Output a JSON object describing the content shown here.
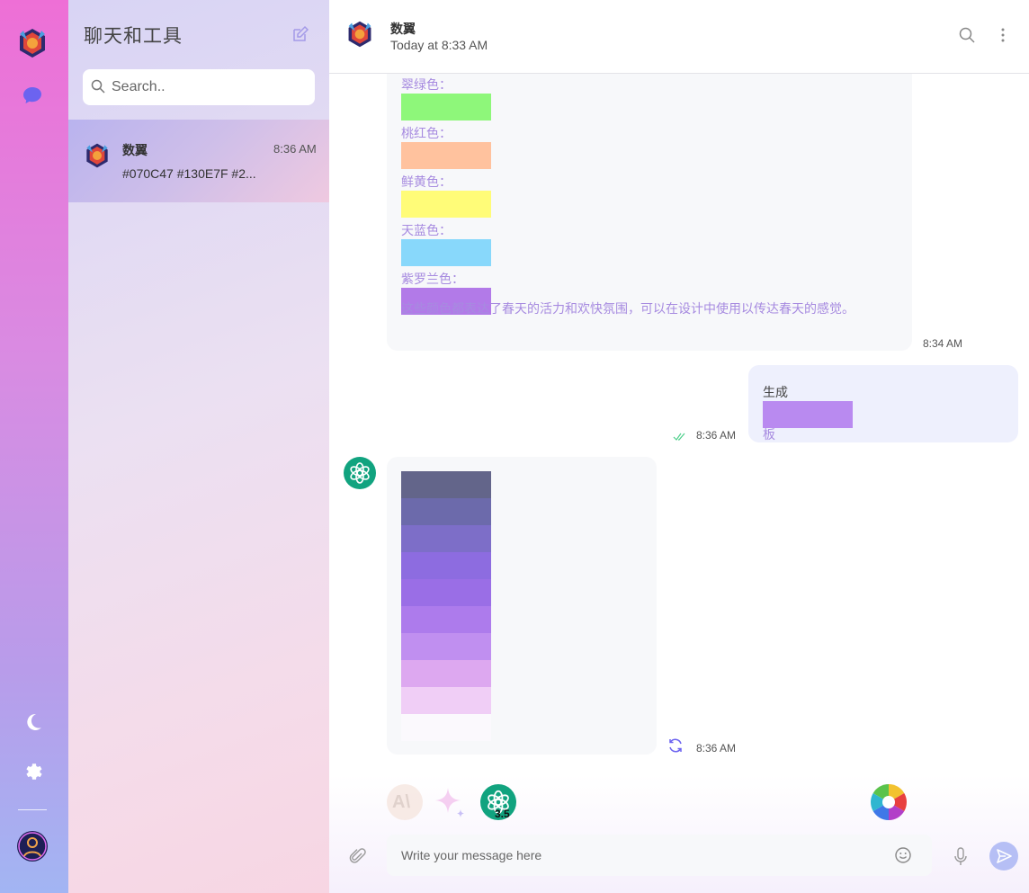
{
  "sidebar": {
    "icons": [
      "app-logo-icon",
      "chat-bubble-icon",
      "moon-icon",
      "gear-icon",
      "user-avatar-icon"
    ]
  },
  "chat_list": {
    "title": "聊天和工具",
    "search_placeholder": "Search..",
    "items": [
      {
        "name": "数翼",
        "time": "8:36 AM",
        "preview": "#070C47 #130E7F #2..."
      }
    ]
  },
  "header": {
    "name": "数翼",
    "subtitle": "Today at 8:33 AM"
  },
  "messages": {
    "color_list": [
      {
        "label": "翠绿色：",
        "color": "#8ef77a"
      },
      {
        "label": "桃红色：",
        "color": "#ffc29e"
      },
      {
        "label": "鲜黄色：",
        "color": "#fffc78"
      },
      {
        "label": "天蓝色：",
        "color": "#88d8fb"
      },
      {
        "label": "紫罗兰色：",
        "color": "#b27ae8"
      }
    ],
    "note": "这些颜色都表达了春天的活力和欢快氛围，可以在设计中使用以传达春天的感觉。",
    "time1": "8:34 AM",
    "user_msg": {
      "line1": "生成",
      "swatch_color": "#b98af0",
      "line2": "板",
      "time": "8:36 AM"
    },
    "palette": {
      "colors": [
        "#63658a",
        "#6c6aab",
        "#7d6ec8",
        "#8d6ce0",
        "#9a6ee6",
        "#ad7bec",
        "#c08ff0",
        "#dda8f0",
        "#f0cef6",
        "#fbf9fd"
      ],
      "time": "8:36 AM"
    }
  },
  "models": {
    "gpt_version": "3.5",
    "anthropic_label": "A\\"
  },
  "composer": {
    "placeholder": "Write your message here"
  }
}
